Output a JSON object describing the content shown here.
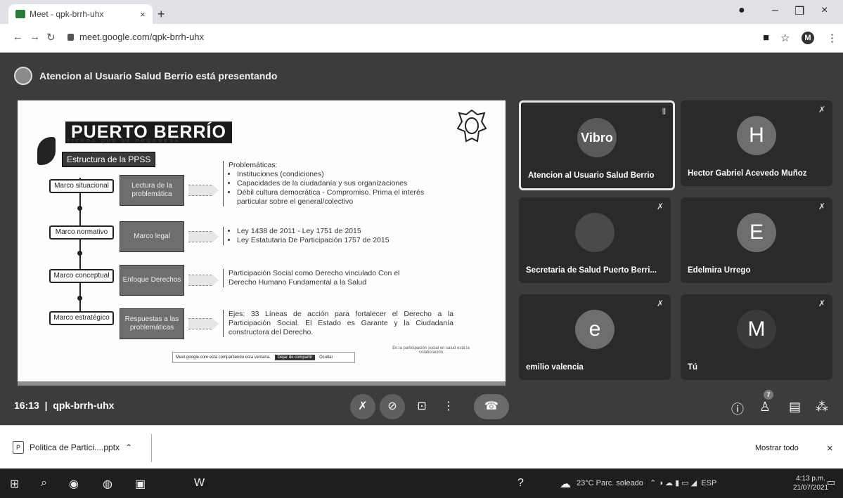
{
  "browser": {
    "tab_title": "Meet - qpk-brrh-uhx",
    "tab_close": "×",
    "new_tab": "+",
    "url": "meet.google.com/qpk-brrh-uhx",
    "window_controls": {
      "minimize": "–",
      "maximize": "❐",
      "close": "×"
    },
    "icons": [
      "back-icon",
      "forward-icon",
      "reload-icon",
      "lock-icon",
      "camera-icon",
      "star-icon",
      "profile-icon",
      "menu-icon"
    ],
    "profile_initial": "M"
  },
  "meet": {
    "presenting_text": "Atencion al Usuario Salud Berrio está presentando",
    "meeting_time": "16:13",
    "meeting_code": "qpk-brrh-uhx",
    "participant_count": "7",
    "controls": [
      "mic-off-icon",
      "camera-off-icon",
      "present-icon",
      "more-icon",
      "hangup-icon"
    ],
    "side_controls": [
      "info-icon",
      "people-icon",
      "chat-icon",
      "activities-icon"
    ]
  },
  "slide": {
    "logo": "PUERTO BERRÍO",
    "logo_sub": "TIERRA QUE SE PROGRESA",
    "subtitle": "Estructura de la PPSS",
    "rows": [
      {
        "marco": "Marco situacional",
        "box": "Lectura de la problemática",
        "heading": "Problemáticas:",
        "items": [
          "Instituciones (condiciones)",
          "Capacidades de la ciudadanía y sus organizaciones",
          "Débil cultura democrática - Compromiso. Prima el interés particular sobre el general/colectivo"
        ]
      },
      {
        "marco": "Marco normativo",
        "box": "Marco legal",
        "items": [
          "Ley 1438 de 2011 - Ley 1751 de 2015",
          "Ley Estatutaria De Participación 1757 de 2015"
        ]
      },
      {
        "marco": "Marco conceptual",
        "box": "Enfoque Derechos",
        "text": "Participación Social como Derecho vinculado Con el Derecho Humano Fundamental a la Salud"
      },
      {
        "marco": "Marco estratégico",
        "box": "Respuestas a las problemáticas",
        "text": "Ejes: 33 Líneas de acción para fortalecer el Derecho a la Participación Social. El Estado es Garante y la Ciudadanía constructora del Derecho."
      }
    ],
    "toolbar_text": "Meet.google.com está compartiendo esta ventana.",
    "toolbar_stop": "Dejar de compartir",
    "toolbar_hide": "Ocultar",
    "footnote": "En la participación social en salud está la colaboración"
  },
  "tiles": [
    {
      "name": "Atencion al Usuario Salud Berrio",
      "avatar": "Vibro",
      "color": "#5a5a5a",
      "active": true
    },
    {
      "name": "Hector Gabriel Acevedo Muñoz",
      "avatar": "H",
      "color": "#6e6e6e"
    },
    {
      "name": "Secretaria de Salud Puerto Berri...",
      "avatar": "",
      "color": "#4a4a4a"
    },
    {
      "name": "Edelmira Urrego",
      "avatar": "E",
      "color": "#6e6e6e"
    },
    {
      "name": "emilio valencia",
      "avatar": "e",
      "color": "#6e6e6e"
    },
    {
      "name": "Tú",
      "avatar": "M",
      "color": "#3a3a3a"
    }
  ],
  "downloads": {
    "file": "Politica de Partici....pptx",
    "show_all": "Mostrar todo",
    "close": "×"
  },
  "taskbar": {
    "weather": "23°C Parc. soleado",
    "language": "ESP",
    "time": "4:13 p.m.",
    "date": "21/07/2021"
  }
}
